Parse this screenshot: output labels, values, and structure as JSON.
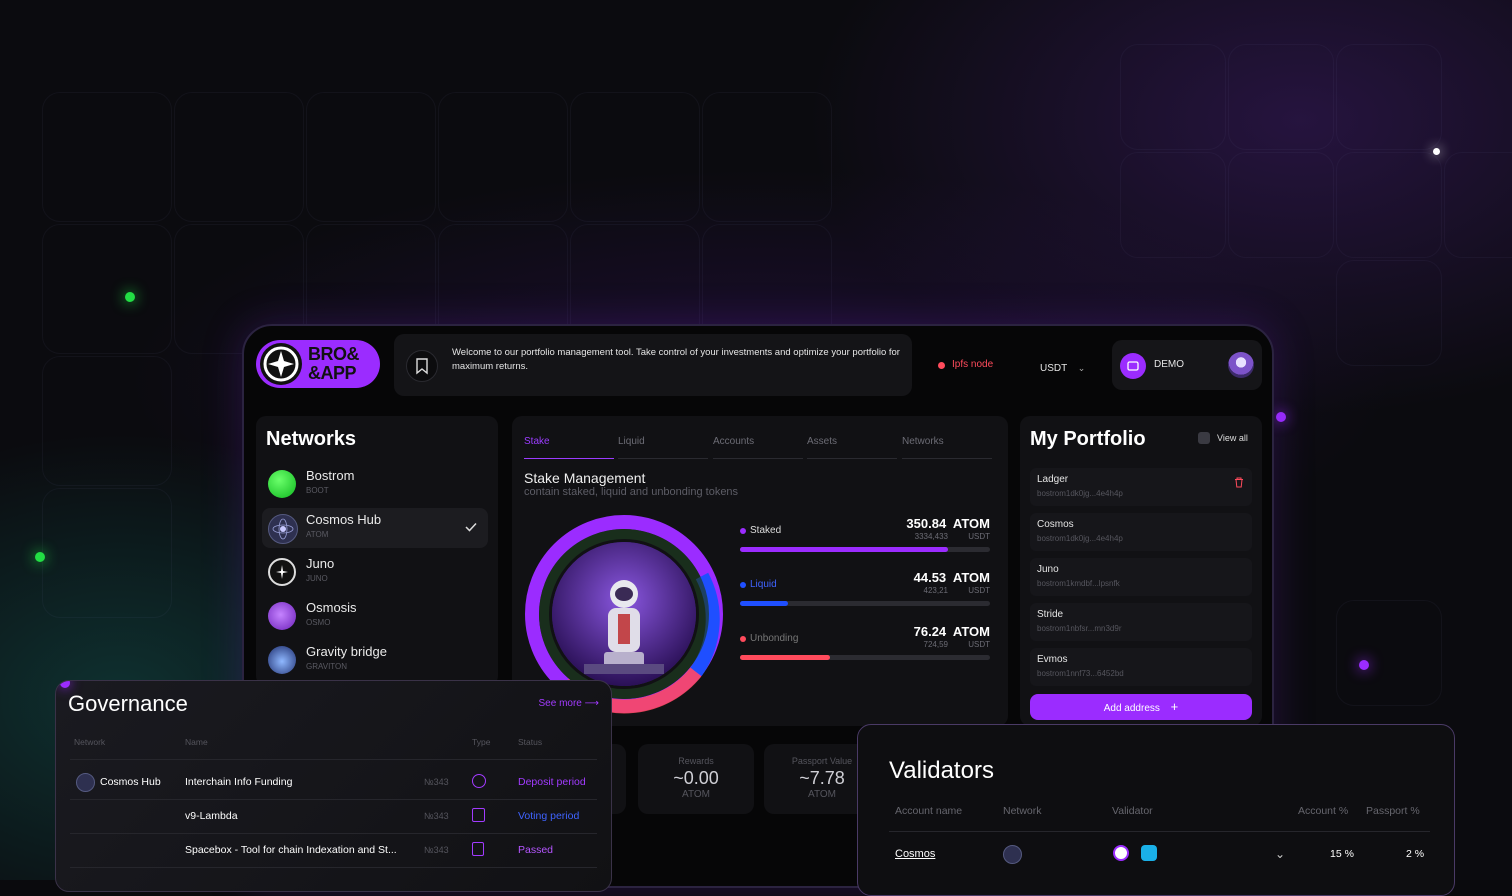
{
  "header": {
    "logo_text_1": "BRO&",
    "logo_text_2": "&APP",
    "welcome_text": "Welcome to our portfolio management tool. Take control of your investments and optimize your portfolio for maximum returns.",
    "node_status": "Ipfs node",
    "currency": "USDT",
    "account_label": "DEMO"
  },
  "networks": {
    "title": "Networks",
    "items": [
      {
        "name": "Bostrom",
        "ticker": "BOOT"
      },
      {
        "name": "Cosmos Hub",
        "ticker": "ATOM"
      },
      {
        "name": "Juno",
        "ticker": "JUNO"
      },
      {
        "name": "Osmosis",
        "ticker": "OSMO"
      },
      {
        "name": "Gravity bridge",
        "ticker": "GRAVITON"
      }
    ]
  },
  "stake": {
    "tabs": [
      "Stake",
      "Liquid",
      "Accounts",
      "Assets",
      "Networks"
    ],
    "title": "Stake Management",
    "subtitle": "contain staked, liquid and unbonding tokens",
    "rows": [
      {
        "label": "Staked",
        "amount": "350.84",
        "unit": "ATOM",
        "usd": "3334,433",
        "usd_unit": "USDT",
        "progress": 0.83,
        "color": "#9b2cff"
      },
      {
        "label": "Liquid",
        "amount": "44.53",
        "unit": "ATOM",
        "usd": "423,21",
        "usd_unit": "USDT",
        "progress": 0.19,
        "color": "#1f4fff"
      },
      {
        "label": "Unbonding",
        "amount": "76.24",
        "unit": "ATOM",
        "usd": "724,59",
        "usd_unit": "USDT",
        "progress": 0.36,
        "color": "#ff4b5c"
      }
    ]
  },
  "portfolio": {
    "title": "My Portfolio",
    "view_all": "View all",
    "accounts": [
      {
        "name": "Ladger",
        "address": "bostrom1dk0jg...4e4h4p"
      },
      {
        "name": "Cosmos",
        "address": "bostrom1dk0jg...4e4h4p"
      },
      {
        "name": "Juno",
        "address": "bostrom1kmdbf...lpsnfk"
      },
      {
        "name": "Stride",
        "address": "bostrom1nbfsr...mn3d9r"
      },
      {
        "name": "Evmos",
        "address": "bostrom1nnf73...6452bd"
      }
    ],
    "add_button": "Add address"
  },
  "stats": [
    {
      "label": "Rewards",
      "value": "~0.00",
      "unit": "ATOM"
    },
    {
      "label": "Passport Value",
      "value": "~7.78",
      "unit": "ATOM"
    }
  ],
  "governance": {
    "title": "Governance",
    "see_more": "See more",
    "columns": [
      "Network",
      "Name",
      "Type",
      "Status"
    ],
    "rows": [
      {
        "network": "Cosmos Hub",
        "name": "Interchain Info Funding",
        "number": "№343",
        "status": "Deposit period",
        "status_color": "#a23bff"
      },
      {
        "network": "",
        "name": "v9-Lambda",
        "number": "№343",
        "status": "Voting period",
        "status_color": "#3f63ff"
      },
      {
        "network": "",
        "name": "Spacebox - Tool for chain Indexation and St...",
        "number": "№343",
        "status": "Passed",
        "status_color": "#b455ff"
      }
    ]
  },
  "validators": {
    "title": "Validators",
    "columns": [
      "Account name",
      "Network",
      "Validator",
      "Account %",
      "Passport %"
    ],
    "rows": [
      {
        "account": "Cosmos",
        "account_pct": "15 %",
        "passport_pct": "2 %"
      }
    ]
  },
  "colors": {
    "accent": "#9b2cff",
    "danger": "#ff4b5c"
  }
}
